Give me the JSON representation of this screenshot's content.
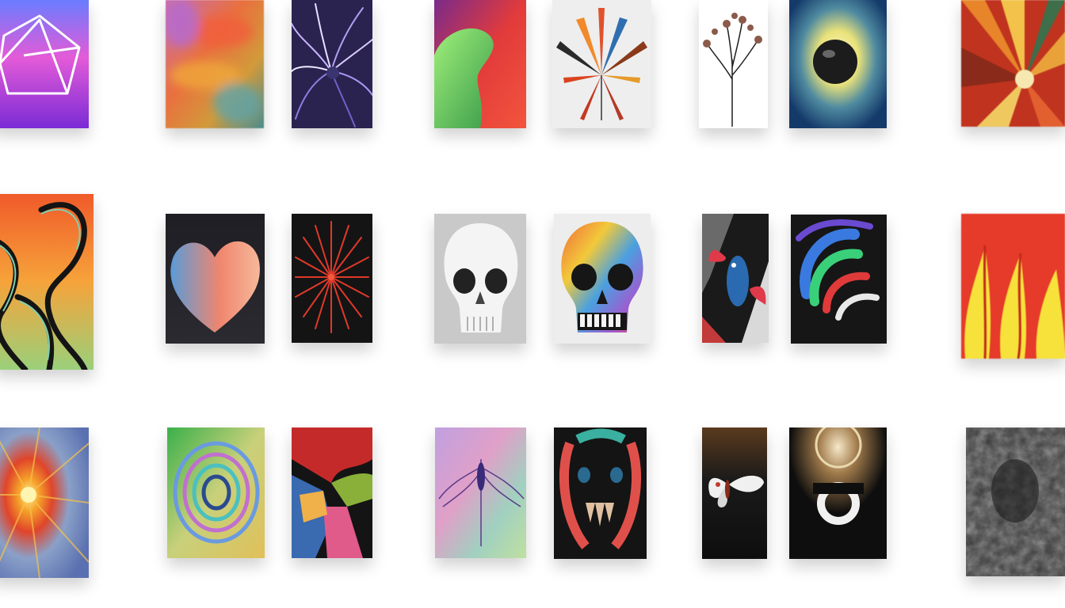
{
  "gallery": {
    "rows": [
      {
        "items": [
          {
            "subject": "geometric-hexagon-art"
          },
          {
            "subject": "abstract-blur-art"
          },
          {
            "subject": "purple-feather-art"
          },
          {
            "subject": "red-green-blob-art"
          },
          {
            "subject": "spiky-leaf-art"
          },
          {
            "subject": "dried-flower-art"
          },
          {
            "subject": "black-sphere-art"
          },
          {
            "subject": "fiery-burst-art"
          }
        ]
      },
      {
        "items": [
          {
            "subject": "tentacle-dragon-art"
          },
          {
            "subject": "heart-art"
          },
          {
            "subject": "red-firework-art"
          },
          {
            "subject": "white-skull-art"
          },
          {
            "subject": "rainbow-skull-art"
          },
          {
            "subject": "fish-art"
          },
          {
            "subject": "neon-swirl-art"
          },
          {
            "subject": "red-yellow-flame-art"
          }
        ]
      },
      {
        "items": [
          {
            "subject": "sun-burst-art"
          },
          {
            "subject": "vortex-art"
          },
          {
            "subject": "abstract-shapes-art"
          },
          {
            "subject": "winged-insect-art"
          },
          {
            "subject": "toothed-face-art"
          },
          {
            "subject": "moth-art"
          },
          {
            "subject": "glowing-rings-art"
          },
          {
            "subject": "grey-texture-art"
          }
        ]
      }
    ]
  }
}
